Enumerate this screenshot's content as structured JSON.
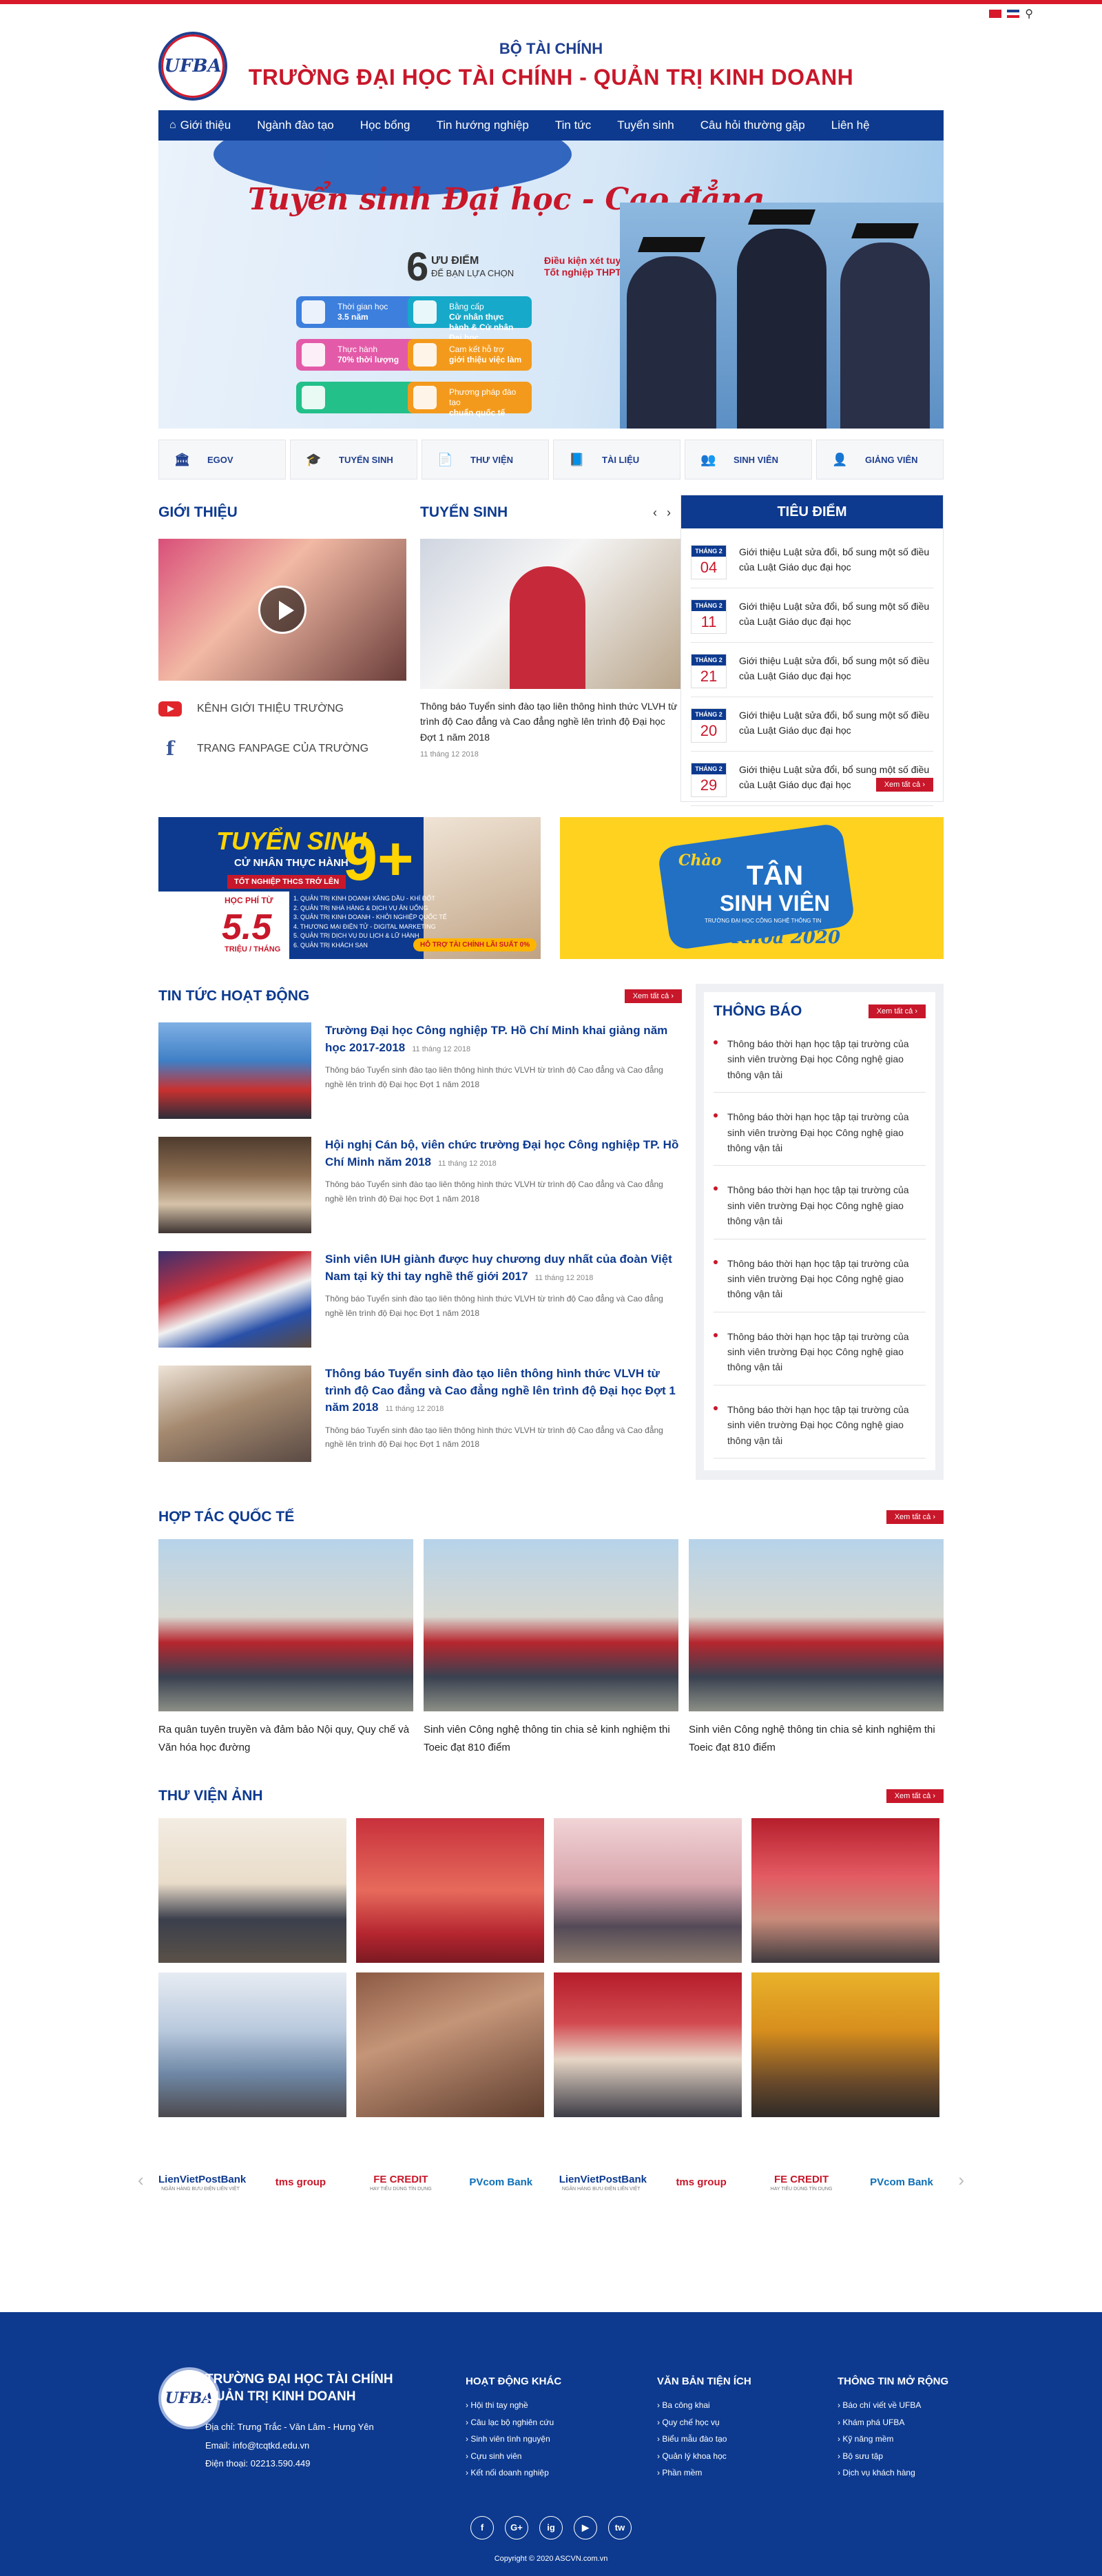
{
  "header": {
    "logo_text": "UFBA",
    "ministry": "BỘ TÀI CHÍNH",
    "school": "TRƯỜNG ĐẠI HỌC TÀI CHÍNH - QUẢN TRỊ KINH DOANH",
    "languages": [
      "vi",
      "en"
    ]
  },
  "nav": {
    "items": [
      "Giới thiệu",
      "Ngành đào tạo",
      "Học bổng",
      "Tin hướng nghiệp",
      "Tin tức",
      "Tuyển sinh",
      "Câu hỏi thường gặp",
      "Liên hệ"
    ]
  },
  "banner": {
    "title": "Tuyển sinh Đại học - Cao đẳng",
    "six": "6",
    "six_label_1": "ƯU ĐIỂM",
    "six_label_2": "ĐỂ BẠN LỰA CHỌN",
    "condition_1": "Điều kiện xét tuyển",
    "condition_2": "Tốt nghiệp THPT",
    "features": [
      {
        "line1": "Thời gian học",
        "line2": "3.5 năm",
        "color": "#3d7fdc"
      },
      {
        "line1": "Bằng cấp",
        "line2": "Cử nhân thực hành & Cử nhân Đại học",
        "color": "#17a9c9"
      },
      {
        "line1": "Thực hành",
        "line2": "70% thời lượng",
        "color": "#e35ba8"
      },
      {
        "line1": "Cam kết hỗ trợ",
        "line2": "giới thiệu việc làm",
        "color": "#f39a1d"
      },
      {
        "line1": "",
        "line2": "",
        "color": "#23c08a"
      },
      {
        "line1": "Phương pháp đào tạo",
        "line2": "chuẩn quốc tế",
        "color": "#f39a1d"
      }
    ]
  },
  "quick_links": [
    "EGOV",
    "TUYỂN SINH",
    "THƯ VIỆN",
    "TÀI LIỆU",
    "SINH VIÊN",
    "GIẢNG VIÊN"
  ],
  "intro": {
    "title": "GIỚI THIỆU",
    "youtube_label": "KÊNH GIỚI THIỆU TRƯỜNG",
    "fanpage_label": "TRANG FANPAGE CỦA TRƯỜNG"
  },
  "admission": {
    "title": "TUYỂN SINH",
    "prev": "‹",
    "next": "›",
    "text": "Thông báo Tuyển sinh đào tạo liên thông hình thức VLVH từ trình độ Cao đẳng và Cao đẳng nghề lên trình độ Đại học Đợt 1 năm 2018",
    "date": "11 tháng 12 2018"
  },
  "focus": {
    "title": "TIÊU ĐIỂM",
    "month_label": "THÁNG 2",
    "items": [
      {
        "day": "04",
        "text": "Giới thiệu Luật sửa đổi, bổ sung một số điều của Luật Giáo dục đại học"
      },
      {
        "day": "11",
        "text": "Giới thiệu Luật sửa đổi, bổ sung một số điều của Luật Giáo dục đại học"
      },
      {
        "day": "21",
        "text": "Giới thiệu Luật sửa đổi, bổ sung một số điều của Luật Giáo dục đại học"
      },
      {
        "day": "20",
        "text": "Giới thiệu Luật sửa đổi, bổ sung một số điều của Luật Giáo dục đại học"
      },
      {
        "day": "29",
        "text": "Giới thiệu Luật sửa đổi, bổ sung một số điều của Luật Giáo dục đại học"
      }
    ],
    "see_all": "Xem tất cả"
  },
  "promo1": {
    "title": "TUYỂN SINH",
    "subtitle": "CỬ NHÂN THỰC HÀNH",
    "tag": "TỐT NGHIỆP THCS TRỞ LÊN",
    "fee_label": "HỌC PHÍ TỪ",
    "fee": "5.5",
    "fee_unit": "TRIỆU / THÁNG",
    "nine": "9+",
    "majors": [
      "1. QUẢN TRỊ KINH DOANH XĂNG DẦU - KHÍ ĐỐT",
      "2. QUẢN TRỊ NHÀ HÀNG & DỊCH VỤ ĂN UỐNG",
      "3. QUẢN TRỊ KINH DOANH - KHỞI NGHIỆP QUỐC TẾ",
      "4. THƯƠNG MẠI ĐIỆN TỬ - DIGITAL MARKETING",
      "5. QUẢN TRỊ DỊCH VỤ DU LỊCH & LỮ HÀNH",
      "6. QUẢN TRỊ KHÁCH SẠN"
    ],
    "badge": "HỖ TRỢ TÀI CHÍNH LÃI SUẤT 0%"
  },
  "promo2": {
    "chao": "Chào",
    "line1": "TÂN",
    "line2": "SINH VIÊN",
    "sub": "TRƯỜNG ĐẠI HỌC CÔNG NGHỆ THÔNG TIN",
    "khoa": "Khóa 2020"
  },
  "news": {
    "title": "TIN TỨC HOẠT ĐỘNG",
    "see_all": "Xem tất cả",
    "items": [
      {
        "title": "Trường Đại học Công nghiệp TP. Hồ Chí Minh khai giảng năm học 2017-2018",
        "date": "11 tháng 12 2018",
        "desc": "Thông báo Tuyển sinh đào tạo liên thông hình thức VLVH từ trình độ Cao đẳng và Cao đẳng nghề lên trình độ Đại học Đợt 1 năm 2018"
      },
      {
        "title": "Hội nghị Cán bộ, viên chức trường Đại học Công nghiệp TP. Hồ Chí Minh năm 2018",
        "date": "11 tháng 12 2018",
        "desc": "Thông báo Tuyển sinh đào tạo liên thông hình thức VLVH từ trình độ Cao đẳng và Cao đẳng nghề lên trình độ Đại học Đợt 1 năm 2018"
      },
      {
        "title": "Sinh viên IUH giành được huy chương duy nhất của đoàn Việt Nam tại kỳ thi tay nghề thế giới 2017",
        "date": "11 tháng 12 2018",
        "desc": "Thông báo Tuyển sinh đào tạo liên thông hình thức VLVH từ trình độ Cao đẳng và Cao đẳng nghề lên trình độ Đại học Đợt 1 năm 2018"
      },
      {
        "title": "Thông báo Tuyển sinh đào tạo liên thông hình thức VLVH từ trình độ Cao đẳng và Cao đẳng nghề lên trình độ Đại học Đợt 1 năm 2018",
        "date": "11 tháng 12 2018",
        "desc": "Thông báo Tuyển sinh đào tạo liên thông hình thức VLVH từ trình độ Cao đẳng và Cao đẳng nghề lên trình độ Đại học Đợt 1 năm 2018"
      }
    ]
  },
  "announcements": {
    "title": "THÔNG BÁO",
    "see_all": "Xem tất cả",
    "items": [
      "Thông báo thời hạn học tập tại trường của sinh viên trường Đại học Công nghệ giao thông vận tải",
      "Thông báo thời hạn học tập tại trường của sinh viên trường Đại học Công nghệ giao thông vận tải",
      "Thông báo thời hạn học tập tại trường của sinh viên trường Đại học Công nghệ giao thông vận tải",
      "Thông báo thời hạn học tập tại trường của sinh viên trường Đại học Công nghệ giao thông vận tải",
      "Thông báo thời hạn học tập tại trường của sinh viên trường Đại học Công nghệ giao thông vận tải",
      "Thông báo thời hạn học tập tại trường của sinh viên trường Đại học Công nghệ giao thông vận tải"
    ]
  },
  "coop": {
    "title": "HỢP TÁC QUỐC TẾ",
    "see_all": "Xem tất cả",
    "items": [
      "Ra quân tuyên truyền và đảm bảo Nội quy, Quy chế và Văn hóa học đường",
      "Sinh viên Công nghệ thông tin chia sẻ kinh nghiệm thi Toeic đạt 810 điểm",
      "Sinh viên Công nghệ thông tin chia sẻ kinh nghiệm thi Toeic đạt 810 điểm"
    ]
  },
  "gallery": {
    "title": "THƯ VIỆN ẢNH",
    "see_all": "Xem tất cả"
  },
  "partners": {
    "items": [
      {
        "name": "LienVietPostBank",
        "sub": "NGÂN HÀNG BƯU ĐIỆN LIÊN VIỆT",
        "color": "#0d3a8f"
      },
      {
        "name": "tms group",
        "sub": "",
        "color": "#c8172a"
      },
      {
        "name": "FE CREDIT",
        "sub": "HAY TIÊU DÙNG TÍN DỤNG",
        "color": "#c8172a"
      },
      {
        "name": "PVcom Bank",
        "sub": "",
        "color": "#0d6fb8"
      },
      {
        "name": "LienVietPostBank",
        "sub": "NGÂN HÀNG BƯU ĐIỆN LIÊN VIỆT",
        "color": "#0d3a8f"
      },
      {
        "name": "tms group",
        "sub": "",
        "color": "#c8172a"
      },
      {
        "name": "FE CREDIT",
        "sub": "HAY TIÊU DÙNG TÍN DỤNG",
        "color": "#c8172a"
      },
      {
        "name": "PVcom Bank",
        "sub": "",
        "color": "#0d6fb8"
      }
    ]
  },
  "footer": {
    "logo_text": "UFBA",
    "school_1": "TRƯỜNG ĐẠI HỌC TÀI CHÍNH",
    "school_2": "QUẢN TRỊ KINH DOANH",
    "address": "Địa chỉ: Trưng Trắc - Văn Lâm - Hưng Yên",
    "email": "Email: info@tcqtkd.edu.vn",
    "phone": "Điện thoại: 02213.590.449",
    "col1": {
      "title": "HOẠT ĐỘNG KHÁC",
      "items": [
        "Hội thi tay nghề",
        "Câu lạc bộ nghiên cứu",
        "Sinh viên tình nguyện",
        "Cựu sinh viên",
        "Kết nối doanh nghiệp"
      ]
    },
    "col2": {
      "title": "VĂN BẢN TIỆN ÍCH",
      "items": [
        "Ba công khai",
        "Quy chế học vụ",
        "Biểu mẫu đào tạo",
        "Quản lý khoa học",
        "Phần mềm"
      ]
    },
    "col3": {
      "title": "THÔNG TIN MỞ RỘNG",
      "items": [
        "Báo chí viết về UFBA",
        "Khám phá UFBA",
        "Kỹ năng mềm",
        "Bộ sưu tập",
        "Dịch vụ khách hàng"
      ]
    },
    "social": [
      "f",
      "G+",
      "ig",
      "▶",
      "tw"
    ],
    "copyright": "Copyright © 2020 ASCVN.com.vn"
  }
}
